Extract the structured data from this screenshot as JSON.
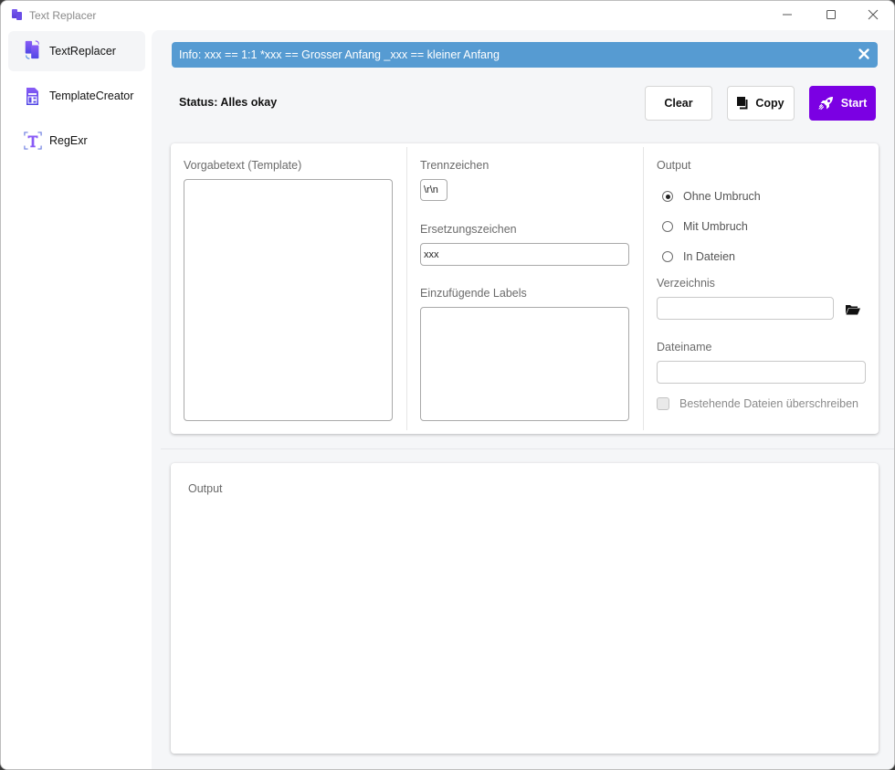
{
  "window": {
    "title": "Text Replacer",
    "controls": [
      "minimize",
      "maximize",
      "close"
    ]
  },
  "sidebar": {
    "items": [
      {
        "label": "TextReplacer",
        "icon": "file-replace-icon",
        "active": true
      },
      {
        "label": "TemplateCreator",
        "icon": "template-document-icon",
        "active": false
      },
      {
        "label": "RegExr",
        "icon": "text-select-icon",
        "active": false
      }
    ]
  },
  "info": {
    "text": "Info: xxx == 1:1 *xxx == Grosser Anfang _xxx == kleiner Anfang",
    "color": "#569bd2"
  },
  "status": {
    "text": "Status: Alles okay"
  },
  "toolbar": {
    "clear_label": "Clear",
    "copy_label": "Copy",
    "start_label": "Start",
    "start_color": "#7b00e3"
  },
  "template": {
    "label": "Vorgabetext (Template)",
    "value": ""
  },
  "settings": {
    "separator_label": "Trennzeichen",
    "separator_value": "\\r\\n",
    "replacement_label": "Ersetzungszeichen",
    "replacement_value": "xxx",
    "labels_label": "Einzufügende Labels",
    "labels_value": ""
  },
  "output_options": {
    "title": "Output",
    "radios": [
      {
        "label": "Ohne Umbruch",
        "checked": true
      },
      {
        "label": "Mit Umbruch",
        "checked": false
      },
      {
        "label": "In Dateien",
        "checked": false
      }
    ],
    "directory_label": "Verzeichnis",
    "directory_value": "",
    "filename_label": "Dateiname",
    "filename_value": "",
    "overwrite_label": "Bestehende Dateien überschreiben",
    "overwrite_checked": false,
    "overwrite_enabled": false
  },
  "output": {
    "label": "Output",
    "value": ""
  }
}
